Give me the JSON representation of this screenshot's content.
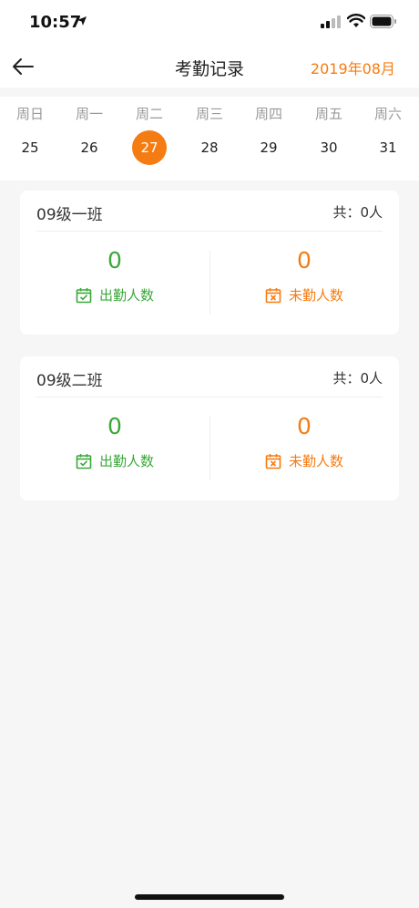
{
  "status_bar": {
    "time": "10:57"
  },
  "nav": {
    "title": "考勤记录",
    "month": "2019年08月"
  },
  "week": [
    {
      "label": "周日",
      "date": "25"
    },
    {
      "label": "周一",
      "date": "26"
    },
    {
      "label": "周二",
      "date": "27",
      "selected": true
    },
    {
      "label": "周三",
      "date": "28"
    },
    {
      "label": "周四",
      "date": "29"
    },
    {
      "label": "周五",
      "date": "30"
    },
    {
      "label": "周六",
      "date": "31"
    }
  ],
  "classes": [
    {
      "name": "09级一班",
      "total": "共：0人",
      "present_count": "0",
      "present_label": "出勤人数",
      "absent_count": "0",
      "absent_label": "未勤人数"
    },
    {
      "name": "09级二班",
      "total": "共：0人",
      "present_count": "0",
      "present_label": "出勤人数",
      "absent_count": "0",
      "absent_label": "未勤人数"
    }
  ],
  "colors": {
    "accent": "#f57c13",
    "present": "#3aa83a"
  }
}
